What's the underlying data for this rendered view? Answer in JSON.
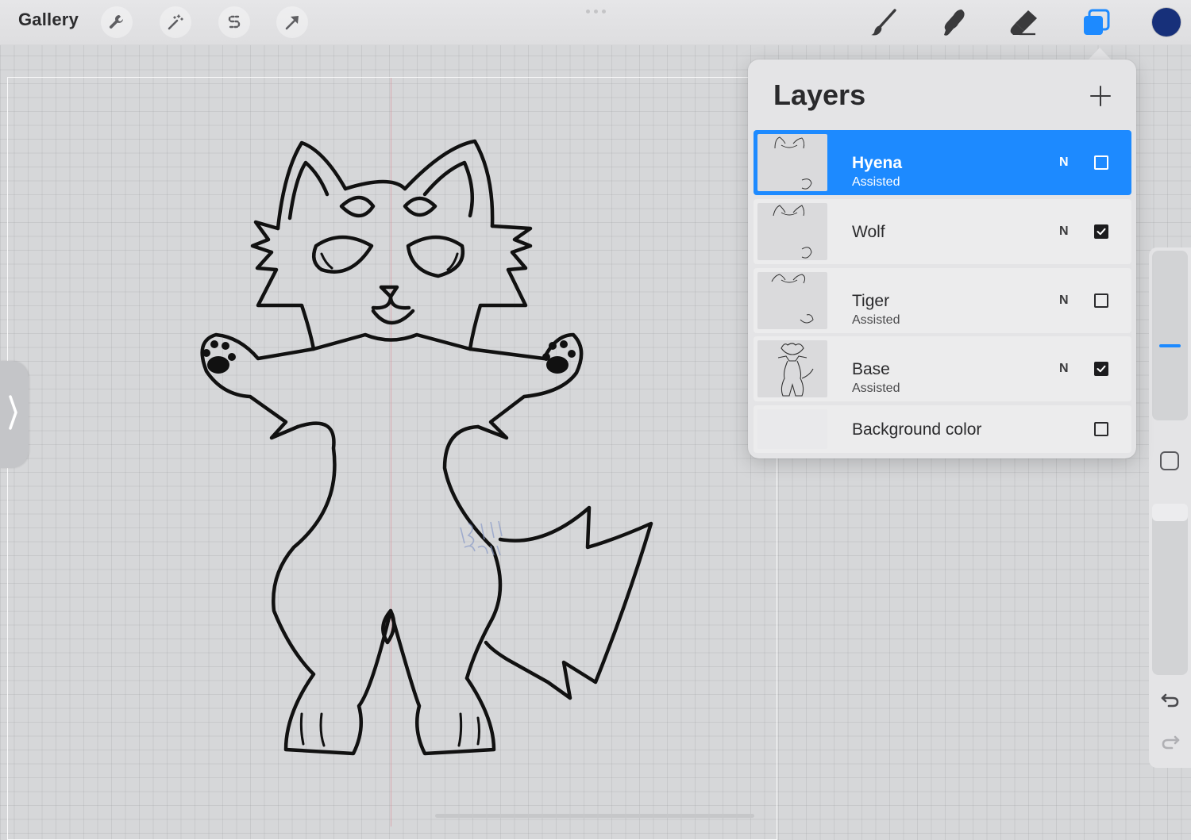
{
  "app": {
    "gallery_label": "Gallery"
  },
  "toolbar": {
    "left_tools": [
      "wrench-icon",
      "magic-wand-icon",
      "selection-s-icon",
      "transform-arrow-icon"
    ],
    "right_tools": [
      "brush-icon",
      "smudge-icon",
      "eraser-icon",
      "layers-icon"
    ],
    "active_tool": "layers-icon",
    "current_color": "#17307a"
  },
  "layers_panel": {
    "title": "Layers",
    "add_label": "+",
    "layers": [
      {
        "name": "Hyena",
        "subtitle": "Assisted",
        "blend": "N",
        "visible": false,
        "selected": true
      },
      {
        "name": "Wolf",
        "subtitle": "",
        "blend": "N",
        "visible": true,
        "selected": false
      },
      {
        "name": "Tiger",
        "subtitle": "Assisted",
        "blend": "N",
        "visible": false,
        "selected": false
      },
      {
        "name": "Base",
        "subtitle": "Assisted",
        "blend": "N",
        "visible": true,
        "selected": false
      }
    ],
    "background": {
      "name": "Background color",
      "visible": false
    }
  },
  "colors": {
    "accent": "#1d8aff",
    "canvas": "#d6d7d9",
    "panel": "#e4e4e6"
  }
}
